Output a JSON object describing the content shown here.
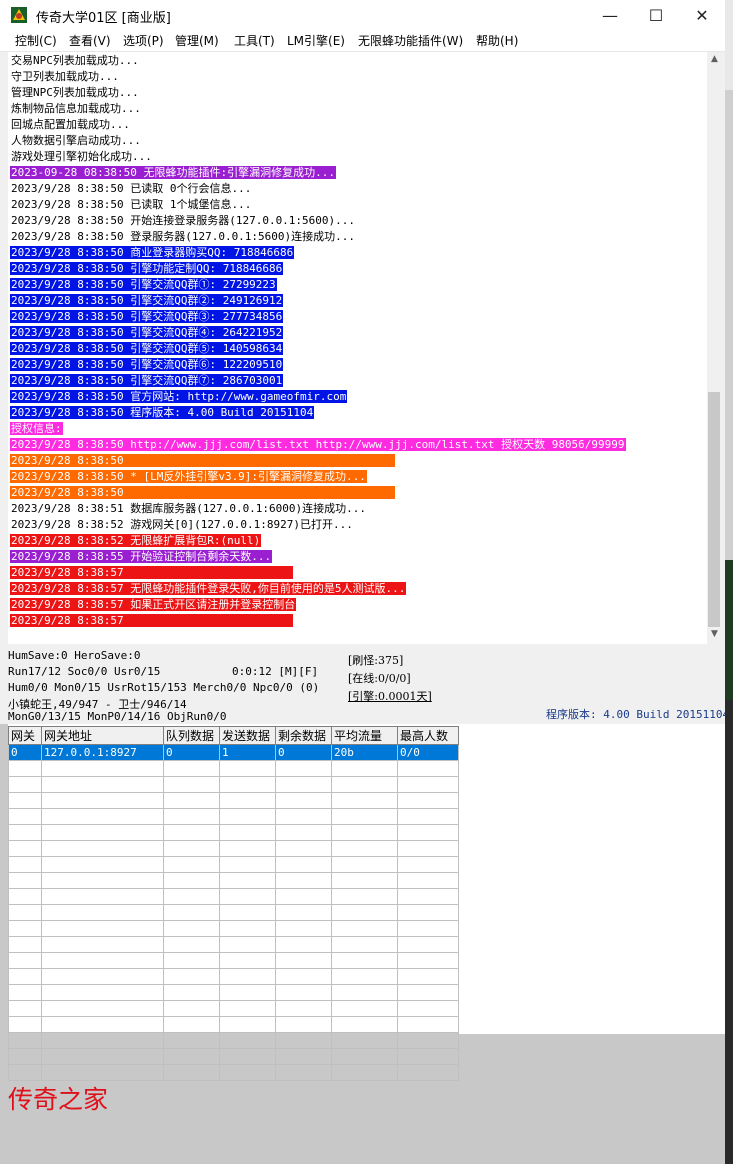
{
  "window": {
    "title": "传奇大学01区 [商业版]",
    "minimize_glyph": "—",
    "maximize_glyph": "☐",
    "close_glyph": "✕",
    "icon": "app-logo-icon"
  },
  "menu": [
    {
      "label": "控制(C)",
      "key": "control"
    },
    {
      "label": "查看(V)",
      "key": "view"
    },
    {
      "label": "选项(P)",
      "key": "options"
    },
    {
      "label": "管理(M)",
      "key": "manage"
    },
    {
      "label": "工具(T)",
      "key": "tools"
    },
    {
      "label": "LM引擎(E)",
      "key": "lm-engine"
    },
    {
      "label": "无限蜂功能插件(W)",
      "key": "plugin"
    },
    {
      "label": "帮助(H)",
      "key": "help"
    }
  ],
  "colors": {
    "purple": "#9a1fd1",
    "blue": "#0014e6",
    "magenta": "#ff2be0",
    "orange": "#ff6a00",
    "red": "#ec1414",
    "selected_row": "#0078d7"
  },
  "log_lines": [
    {
      "text": "交易NPC列表加载成功...",
      "fg": "#000000",
      "bg": ""
    },
    {
      "text": "守卫列表加载成功...",
      "fg": "#000000",
      "bg": ""
    },
    {
      "text": "管理NPC列表加载成功...",
      "fg": "#000000",
      "bg": ""
    },
    {
      "text": "炼制物品信息加载成功...",
      "fg": "#000000",
      "bg": ""
    },
    {
      "text": "回城点配置加载成功...",
      "fg": "#000000",
      "bg": ""
    },
    {
      "text": "人物数据引擎启动成功...",
      "fg": "#000000",
      "bg": ""
    },
    {
      "text": "游戏处理引擎初始化成功...",
      "fg": "#000000",
      "bg": ""
    },
    {
      "text": "2023-09-28 08:38:50 无限蜂功能插件:引擎漏洞修复成功...",
      "fg": "#ffffff",
      "bg": "#9a1fd1"
    },
    {
      "text": "2023/9/28 8:38:50 已读取 0个行会信息...",
      "fg": "#000000",
      "bg": ""
    },
    {
      "text": "2023/9/28 8:38:50 已读取 1个城堡信息...",
      "fg": "#000000",
      "bg": ""
    },
    {
      "text": "2023/9/28 8:38:50 开始连接登录服务器(127.0.0.1:5600)...",
      "fg": "#000000",
      "bg": ""
    },
    {
      "text": "2023/9/28 8:38:50 登录服务器(127.0.0.1:5600)连接成功...",
      "fg": "#000000",
      "bg": ""
    },
    {
      "text": "2023/9/28 8:38:50 商业登录器购买QQ: 718846686",
      "fg": "#ffffff",
      "bg": "#0014e6"
    },
    {
      "text": "2023/9/28 8:38:50 引擎功能定制QQ: 718846686",
      "fg": "#ffffff",
      "bg": "#0014e6"
    },
    {
      "text": "2023/9/28 8:38:50 引擎交流QQ群①: 27299223",
      "fg": "#ffffff",
      "bg": "#0014e6"
    },
    {
      "text": "2023/9/28 8:38:50 引擎交流QQ群②: 249126912",
      "fg": "#ffffff",
      "bg": "#0014e6"
    },
    {
      "text": "2023/9/28 8:38:50 引擎交流QQ群③: 277734856",
      "fg": "#ffffff",
      "bg": "#0014e6"
    },
    {
      "text": "2023/9/28 8:38:50 引擎交流QQ群④: 264221952",
      "fg": "#ffffff",
      "bg": "#0014e6"
    },
    {
      "text": "2023/9/28 8:38:50 引擎交流QQ群⑤: 140598634",
      "fg": "#ffffff",
      "bg": "#0014e6"
    },
    {
      "text": "2023/9/28 8:38:50 引擎交流QQ群⑥: 122209510",
      "fg": "#ffffff",
      "bg": "#0014e6"
    },
    {
      "text": "2023/9/28 8:38:50 引擎交流QQ群⑦: 286703001",
      "fg": "#ffffff",
      "bg": "#0014e6"
    },
    {
      "text": "2023/9/28 8:38:50 官方网站: http://www.gameofmir.com",
      "fg": "#ffffff",
      "bg": "#0014e6"
    },
    {
      "text": "2023/9/28 8:38:50 程序版本: 4.00 Build 20151104",
      "fg": "#ffffff",
      "bg": "#0014e6"
    },
    {
      "text": "授权信息:",
      "fg": "#ffffff",
      "bg": "#ff2be0"
    },
    {
      "text": "2023/9/28 8:38:50 http://www.jjj.com/list.txt http://www.jjj.com/list.txt 授权天数 98056/99999",
      "fg": "#ffffff",
      "bg": "#ff2be0"
    },
    {
      "text": "2023/9/28 8:38:50",
      "fg": "#ffffff",
      "bg": "#ff6a00"
    },
    {
      "text": "2023/9/28 8:38:50 * [LM反外挂引擎v3.9]:引擎漏洞修复成功...",
      "fg": "#ffffff",
      "bg": "#ff6a00"
    },
    {
      "text": "2023/9/28 8:38:50",
      "fg": "#ffffff",
      "bg": "#ff6a00"
    },
    {
      "text": "2023/9/28 8:38:51 数据库服务器(127.0.0.1:6000)连接成功...",
      "fg": "#000000",
      "bg": ""
    },
    {
      "text": "2023/9/28 8:38:52 游戏网关[0](127.0.0.1:8927)已打开...",
      "fg": "#000000",
      "bg": ""
    },
    {
      "text": "2023/9/28 8:38:52 无限蜂扩展背包R:(null)",
      "fg": "#ffffff",
      "bg": "#ec1414"
    },
    {
      "text": "2023/9/28 8:38:55 开始验证控制台剩余天数...",
      "fg": "#ffffff",
      "bg": "#9a1fd1"
    },
    {
      "text": "2023/9/28 8:38:57",
      "fg": "#ffffff",
      "bg": "#ec1414"
    },
    {
      "text": "2023/9/28 8:38:57 无限蜂功能插件登录失败,你目前使用的是5人测试版...",
      "fg": "#ffffff",
      "bg": "#ec1414"
    },
    {
      "text": "2023/9/28 8:38:57 如果正式开区请注册并登录控制台",
      "fg": "#ffffff",
      "bg": "#ec1414"
    },
    {
      "text": "2023/9/28 8:38:57",
      "fg": "#ffffff",
      "bg": "#ec1414"
    }
  ],
  "status": {
    "line1": "HumSave:0 HeroSave:0",
    "line2": "Run17/12 Soc0/0 Usr0/15",
    "line2_time": "0:0:12 [M][F]",
    "line3": "Hum0/0 Mon0/15 UsrRot15/153 Merch0/0 Npc0/0 (0)",
    "line4": "小镇蛇王,49/947 - 卫士/946/14",
    "line5": "MonG0/13/15 MonP0/14/16 ObjRun0/0",
    "monster_refresh": "[刷怪:375]",
    "online": "[在线:0/0/0]",
    "engine": "[引擎:0.0001天]",
    "version": "程序版本: 4.00 Build 20151104"
  },
  "gateway_table": {
    "headers": [
      "网关",
      "网关地址",
      "队列数据",
      "发送数据",
      "剩余数据",
      "平均流量",
      "最高人数"
    ],
    "rows": [
      [
        "0",
        "127.0.0.1:8927",
        "0",
        "1",
        "0",
        "20b",
        "0/0"
      ]
    ],
    "empty_rows": 20
  },
  "watermark": "传奇之家"
}
